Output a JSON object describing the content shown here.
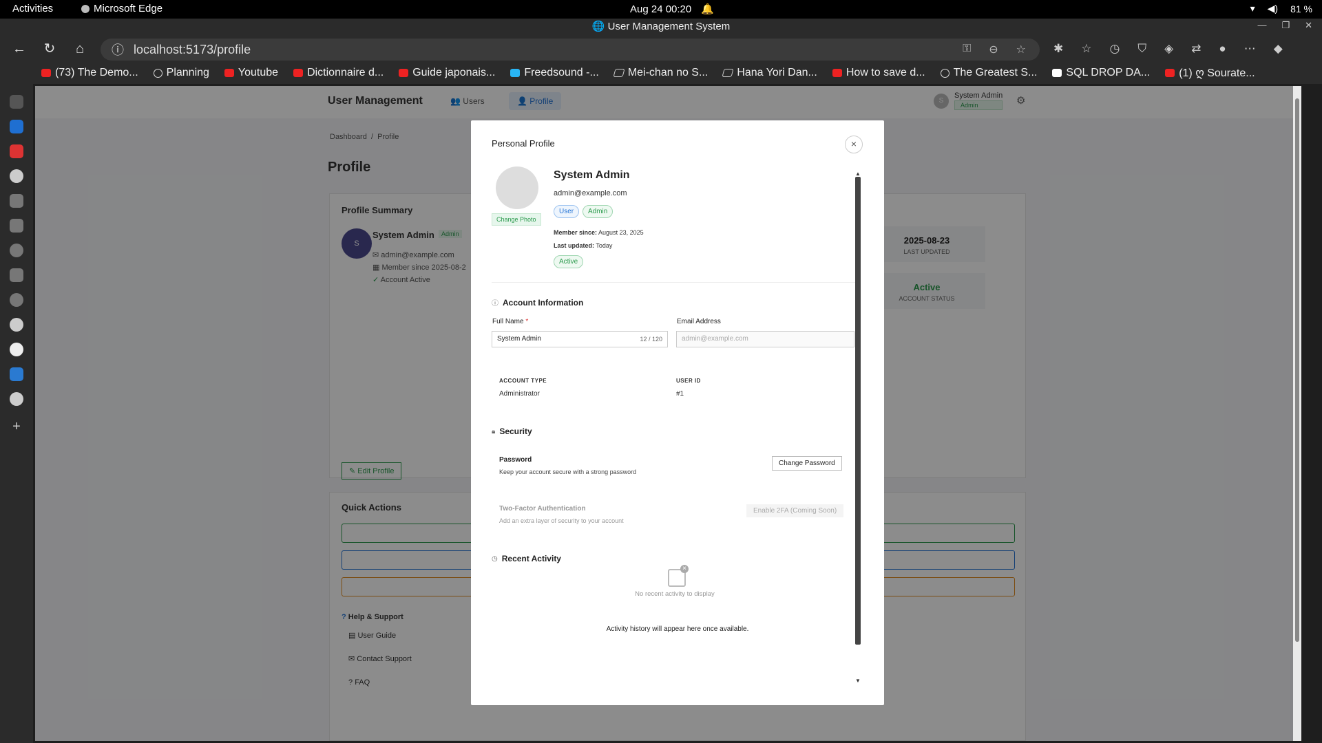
{
  "os": {
    "activities": "Activities",
    "app_name": "Microsoft Edge",
    "datetime": "Aug 24  00:20",
    "battery": "81 %"
  },
  "browser": {
    "window_title": "User Management System",
    "url": "localhost:5173/profile",
    "favorites": [
      {
        "label": "(73) The Demo...",
        "icon": "youtube-icon"
      },
      {
        "label": "Planning",
        "icon": "globe-icon"
      },
      {
        "label": "Youtube",
        "icon": "youtube-icon"
      },
      {
        "label": "Dictionnaire d...",
        "icon": "dictionary-icon"
      },
      {
        "label": "Guide japonais...",
        "icon": "bookmark-icon"
      },
      {
        "label": "Freedsound -...",
        "icon": "freesound-icon"
      },
      {
        "label": "Mei-chan no S...",
        "icon": "nyaa-icon"
      },
      {
        "label": "Hana Yori Dan...",
        "icon": "nyaa-icon"
      },
      {
        "label": "How to save d...",
        "icon": "youtube-icon"
      },
      {
        "label": "The Greatest S...",
        "icon": "globe-icon"
      },
      {
        "label": "SQL DROP DA...",
        "icon": "sql-icon"
      },
      {
        "label": "(1) ღ Sourate...",
        "icon": "youtube-icon"
      }
    ]
  },
  "app": {
    "brand": "User Management",
    "nav_users": "Users",
    "nav_profile": "Profile",
    "user_name": "System Admin",
    "user_badge": "Admin",
    "avatar_letter": "S",
    "breadcrumb_home": "Dashboard",
    "breadcrumb_sep": "/",
    "breadcrumb_current": "Profile",
    "page_title": "Profile",
    "summary": {
      "title": "Profile Summary",
      "name": "System Admin",
      "badge": "Admin",
      "email": "admin@example.com",
      "member_since": "Member since 2025-08-2",
      "status": "Account Active",
      "stat_last_updated_value": "2025-08-23",
      "stat_last_updated_label": "LAST UPDATED",
      "stat_status_value": "Active",
      "stat_status_label": "ACCOUNT STATUS",
      "edit_button": "Edit Profile"
    },
    "quick_actions_title": "Quick Actions",
    "help": {
      "title": "Help & Support",
      "user_guide": "User Guide",
      "contact": "Contact Support",
      "faq": "FAQ"
    }
  },
  "modal": {
    "title": "Personal Profile",
    "close": "×",
    "change_photo": "Change Photo",
    "name": "System Admin",
    "email": "admin@example.com",
    "badge_user": "User",
    "badge_admin": "Admin",
    "member_since_label": "Member since:",
    "member_since_value": "August 23, 2025",
    "last_updated_label": "Last updated:",
    "last_updated_value": "Today",
    "status": "Active",
    "account_info_title": "Account Information",
    "full_name_label": "Full Name",
    "full_name_value": "System Admin",
    "full_name_count": "12 / 120",
    "email_label": "Email Address",
    "email_placeholder": "admin@example.com",
    "account_type_label": "ACCOUNT TYPE",
    "account_type_value": "Administrator",
    "user_id_label": "USER ID",
    "user_id_value": "#1",
    "security_title": "Security",
    "password_title": "Password",
    "password_sub": "Keep your account secure with a strong password",
    "change_password": "Change Password",
    "tfa_title": "Two-Factor Authentication",
    "tfa_sub": "Add an extra layer of security to your account",
    "tfa_button": "Enable 2FA (Coming Soon)",
    "activity_title": "Recent Activity",
    "activity_empty": "No recent activity to display",
    "activity_note": "Activity history will appear here once available."
  },
  "colors": {
    "accent_green": "#2a9a4c",
    "accent_blue": "#2474d6",
    "qa_green": "#2a9a4c",
    "qa_blue": "#2474d6",
    "qa_orange": "#e08a1e"
  }
}
